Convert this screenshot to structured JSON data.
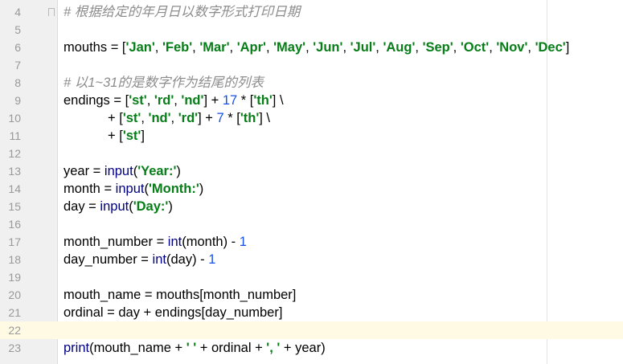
{
  "editor": {
    "lines": [
      {
        "num": "4",
        "segs": [
          {
            "t": "# 根据给定的年月日以数字形式打印日期",
            "k": "comment"
          }
        ]
      },
      {
        "num": "5",
        "segs": []
      },
      {
        "num": "6",
        "segs": [
          {
            "t": "mouths = [",
            "k": "plain"
          },
          {
            "t": "'Jan'",
            "k": "str"
          },
          {
            "t": ", ",
            "k": "plain"
          },
          {
            "t": "'Feb'",
            "k": "str"
          },
          {
            "t": ", ",
            "k": "plain"
          },
          {
            "t": "'Mar'",
            "k": "str"
          },
          {
            "t": ", ",
            "k": "plain"
          },
          {
            "t": "'Apr'",
            "k": "str"
          },
          {
            "t": ", ",
            "k": "plain"
          },
          {
            "t": "'May'",
            "k": "str"
          },
          {
            "t": ", ",
            "k": "plain"
          },
          {
            "t": "'Jun'",
            "k": "str"
          },
          {
            "t": ", ",
            "k": "plain"
          },
          {
            "t": "'Jul'",
            "k": "str"
          },
          {
            "t": ", ",
            "k": "plain"
          },
          {
            "t": "'Aug'",
            "k": "str"
          },
          {
            "t": ", ",
            "k": "plain"
          },
          {
            "t": "'Sep'",
            "k": "str"
          },
          {
            "t": ", ",
            "k": "plain"
          },
          {
            "t": "'Oct'",
            "k": "str"
          },
          {
            "t": ", ",
            "k": "plain"
          },
          {
            "t": "'Nov'",
            "k": "str"
          },
          {
            "t": ", ",
            "k": "plain"
          },
          {
            "t": "'Dec'",
            "k": "str"
          },
          {
            "t": "]",
            "k": "plain"
          }
        ]
      },
      {
        "num": "7",
        "segs": []
      },
      {
        "num": "8",
        "segs": [
          {
            "t": "# 以1~31的是数字作为结尾的列表",
            "k": "comment"
          }
        ]
      },
      {
        "num": "9",
        "segs": [
          {
            "t": "endings = [",
            "k": "plain"
          },
          {
            "t": "'st'",
            "k": "str"
          },
          {
            "t": ", ",
            "k": "plain"
          },
          {
            "t": "'rd'",
            "k": "str"
          },
          {
            "t": ", ",
            "k": "plain"
          },
          {
            "t": "'nd'",
            "k": "str"
          },
          {
            "t": "] + ",
            "k": "plain"
          },
          {
            "t": "17",
            "k": "num"
          },
          {
            "t": " * [",
            "k": "plain"
          },
          {
            "t": "'th'",
            "k": "str"
          },
          {
            "t": "] \\",
            "k": "plain"
          }
        ]
      },
      {
        "num": "10",
        "segs": [
          {
            "t": "            + [",
            "k": "plain"
          },
          {
            "t": "'st'",
            "k": "str"
          },
          {
            "t": ", ",
            "k": "plain"
          },
          {
            "t": "'nd'",
            "k": "str"
          },
          {
            "t": ", ",
            "k": "plain"
          },
          {
            "t": "'rd'",
            "k": "str"
          },
          {
            "t": "] + ",
            "k": "plain"
          },
          {
            "t": "7",
            "k": "num"
          },
          {
            "t": " * [",
            "k": "plain"
          },
          {
            "t": "'th'",
            "k": "str"
          },
          {
            "t": "] \\",
            "k": "plain"
          }
        ]
      },
      {
        "num": "11",
        "segs": [
          {
            "t": "            + [",
            "k": "plain"
          },
          {
            "t": "'st'",
            "k": "str"
          },
          {
            "t": "]",
            "k": "plain"
          }
        ]
      },
      {
        "num": "12",
        "segs": []
      },
      {
        "num": "13",
        "segs": [
          {
            "t": "year = ",
            "k": "plain"
          },
          {
            "t": "input",
            "k": "builtin"
          },
          {
            "t": "(",
            "k": "plain"
          },
          {
            "t": "'Year:'",
            "k": "str"
          },
          {
            "t": ")",
            "k": "plain"
          }
        ]
      },
      {
        "num": "14",
        "segs": [
          {
            "t": "month = ",
            "k": "plain"
          },
          {
            "t": "input",
            "k": "builtin"
          },
          {
            "t": "(",
            "k": "plain"
          },
          {
            "t": "'Month:'",
            "k": "str"
          },
          {
            "t": ")",
            "k": "plain"
          }
        ]
      },
      {
        "num": "15",
        "segs": [
          {
            "t": "day = ",
            "k": "plain"
          },
          {
            "t": "input",
            "k": "builtin"
          },
          {
            "t": "(",
            "k": "plain"
          },
          {
            "t": "'Day:'",
            "k": "str"
          },
          {
            "t": ")",
            "k": "plain"
          }
        ]
      },
      {
        "num": "16",
        "segs": []
      },
      {
        "num": "17",
        "segs": [
          {
            "t": "month_number = ",
            "k": "plain"
          },
          {
            "t": "int",
            "k": "builtin"
          },
          {
            "t": "(month) - ",
            "k": "plain"
          },
          {
            "t": "1",
            "k": "num"
          }
        ]
      },
      {
        "num": "18",
        "segs": [
          {
            "t": "day_number = ",
            "k": "plain"
          },
          {
            "t": "int",
            "k": "builtin"
          },
          {
            "t": "(day) - ",
            "k": "plain"
          },
          {
            "t": "1",
            "k": "num"
          }
        ]
      },
      {
        "num": "19",
        "segs": []
      },
      {
        "num": "20",
        "segs": [
          {
            "t": "mouth_name = mouths[month_number]",
            "k": "plain"
          }
        ]
      },
      {
        "num": "21",
        "segs": [
          {
            "t": "ordinal = day + endings[day_number]",
            "k": "plain"
          }
        ]
      },
      {
        "num": "22",
        "segs": [],
        "current": true
      },
      {
        "num": "23",
        "segs": [
          {
            "t": "print",
            "k": "builtin"
          },
          {
            "t": "(mouth_name + ",
            "k": "plain"
          },
          {
            "t": "' '",
            "k": "str"
          },
          {
            "t": " + ordinal + ",
            "k": "plain"
          },
          {
            "t": "', '",
            "k": "str"
          },
          {
            "t": " + year)",
            "k": "plain"
          }
        ]
      }
    ]
  }
}
